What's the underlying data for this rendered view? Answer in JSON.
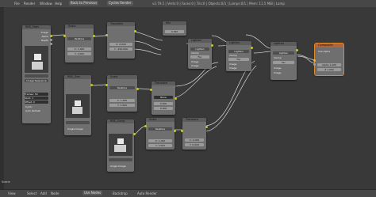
{
  "top": {
    "menu": [
      "File",
      "Render",
      "Window",
      "Help"
    ],
    "back_label": "Back to Previous",
    "engine": "Cycles Render",
    "stats": "v2.79.5 | Verts:0 | Faces:0 | Tris:0 | Objects:0/1 | Lamps:0/1 | Mem: 11.5 MiB | Lamp"
  },
  "nodes": {
    "rl1": {
      "title": "RBS_Mats"
    },
    "img1": {
      "out1": "Image",
      "out2": "Alpha",
      "out3": "Depth",
      "src": "Image Sequence",
      "frames": "Frames:",
      "frames_val": "54",
      "start": "Start:",
      "start_val": "1",
      "offset": "Offset:",
      "offset_val": "0",
      "cyclic": "Cyclic",
      "auto": "Auto Refresh"
    },
    "scale": {
      "title": "Scale",
      "mode": "Relative",
      "x": "X:",
      "x_val": "1.000",
      "y": "Y:",
      "y_val": "1.000"
    },
    "trans1": {
      "title": "Translate",
      "x": "X:",
      "x_val": "0.000",
      "y": "Y:",
      "y_val": "-400.000"
    },
    "mix1": {
      "title": "Mix",
      "val": "0.490"
    },
    "alpha1": {
      "title": "Lighten",
      "clamp": "Clamp",
      "fac": "Fac",
      "image": "Image"
    },
    "alpha2": {
      "title": "Lighten",
      "clamp": "Clamp",
      "fac": "Fac",
      "image": "Image"
    },
    "alpha3": {
      "title": "Lighten",
      "clamp": "Clamp",
      "fac": "Fac",
      "image": "Image"
    },
    "comp": {
      "title": "Composite",
      "use_alpha": "Use Alpha",
      "alpha": "Alpha",
      "alpha_val": "1.000",
      "z": "Z",
      "z_val": "1.000"
    },
    "img2": {
      "title": "RBS_Gen",
      "src": "Single Image"
    },
    "scale2": {
      "title": "Scale",
      "mode": "Relative",
      "x": "X:",
      "x_val": "1.000",
      "y": "Y:",
      "y_val": "1.000"
    },
    "trans2": {
      "title": "Translate",
      "wrap": "None",
      "x_val": "0.000",
      "y_val": "0.000"
    },
    "img3": {
      "title": "RBS_Gang",
      "src": "Single Image"
    },
    "scale3": {
      "title": "Scale",
      "mode": "Relative",
      "x": "X:",
      "x_val": "1.000",
      "y": "Y:",
      "y_val": "1.000"
    },
    "trans3": {
      "title": "Translate",
      "x": "X:",
      "x_val": "0.000",
      "y": "Y:",
      "y_val": "0.000"
    }
  },
  "scene_label": "Scene",
  "bottom": {
    "items": [
      "View",
      "Select",
      "Add",
      "Node"
    ],
    "use_nodes": "Use Nodes",
    "backdrop": "Backdrop",
    "auto_render": "Auto Render"
  }
}
